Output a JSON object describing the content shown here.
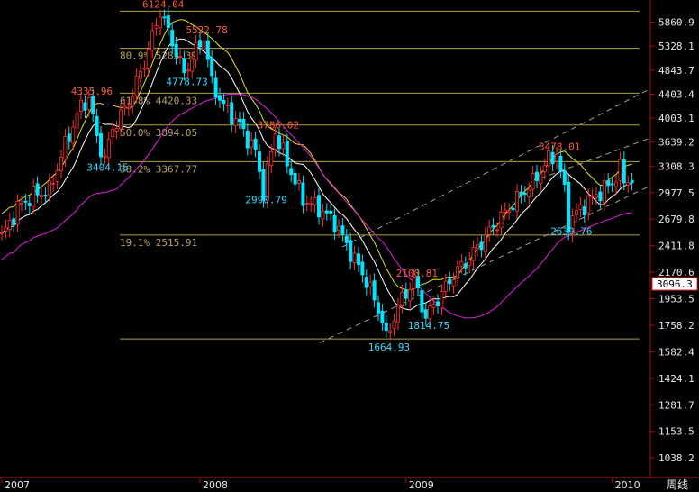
{
  "period_label": "周线",
  "current_price": "3096.3",
  "chart_data": {
    "type": "candlestick",
    "y_scale": "log",
    "ylim": [
      960,
      6400
    ],
    "y_ticks": [
      "5860.9",
      "5328.1",
      "4843.7",
      "4403.4",
      "4003.1",
      "3639.2",
      "3308.3",
      "2977.5",
      "2679.8",
      "2411.8",
      "2170.6",
      "1953.5",
      "1758.2",
      "1582.4",
      "1424.1",
      "1281.7",
      "1153.5",
      "1038.2"
    ],
    "x_ticks": [
      "2007",
      "2008",
      "2009",
      "2010"
    ],
    "colors": {
      "up": "#ff3030",
      "down": "#00e5ff",
      "ma_short": "#ffffff",
      "ma_upper": "#e8e020",
      "ma_lower": "#e020e0",
      "fib": "#b0a040",
      "channel": "#a0a0a0"
    },
    "fib_levels": [
      {
        "label": "",
        "value": 6124
      },
      {
        "label": "80.9% 5283.39",
        "value": 5283
      },
      {
        "label": "61.8% 4420.33",
        "value": 4420
      },
      {
        "label": "50.0% 3894.05",
        "value": 3894
      },
      {
        "label": "38.2% 3367.77",
        "value": 3368
      },
      {
        "label": "19.1% 2515.91",
        "value": 2516
      },
      {
        "label": "",
        "value": 1665
      }
    ],
    "annotations": [
      {
        "text": "6124.04",
        "kind": "high",
        "x": 40,
        "value": 6124
      },
      {
        "text": "5522.78",
        "kind": "high",
        "x": 51,
        "value": 5523
      },
      {
        "text": "4335.96",
        "kind": "high",
        "x": 22,
        "value": 4336
      },
      {
        "text": "4778.73",
        "kind": "low",
        "x": 46,
        "value": 4779
      },
      {
        "text": "3404.15",
        "kind": "low",
        "x": 26,
        "value": 3404
      },
      {
        "text": "3786.02",
        "kind": "high",
        "x": 69,
        "value": 3786
      },
      {
        "text": "2990.79",
        "kind": "low",
        "x": 66,
        "value": 2991
      },
      {
        "text": "2100.81",
        "kind": "high",
        "x": 104,
        "value": 2101
      },
      {
        "text": "1814.75",
        "kind": "low",
        "x": 107,
        "value": 1815
      },
      {
        "text": "1664.93",
        "kind": "low",
        "x": 97,
        "value": 1665
      },
      {
        "text": "3478.01",
        "kind": "high",
        "x": 140,
        "value": 3478
      },
      {
        "text": "2639.76",
        "kind": "low",
        "x": 143,
        "value": 2640
      }
    ],
    "anchors": [
      [
        0,
        2500
      ],
      [
        4,
        2800
      ],
      [
        8,
        2950
      ],
      [
        12,
        3000
      ],
      [
        16,
        3600
      ],
      [
        20,
        4200
      ],
      [
        22,
        4336
      ],
      [
        24,
        3700
      ],
      [
        26,
        3404
      ],
      [
        28,
        3850
      ],
      [
        32,
        4250
      ],
      [
        36,
        5000
      ],
      [
        40,
        6124
      ],
      [
        44,
        5200
      ],
      [
        46,
        4779
      ],
      [
        48,
        5100
      ],
      [
        51,
        5523
      ],
      [
        53,
        4600
      ],
      [
        56,
        4200
      ],
      [
        60,
        3900
      ],
      [
        64,
        3500
      ],
      [
        66,
        2991
      ],
      [
        69,
        3786
      ],
      [
        72,
        3350
      ],
      [
        76,
        2900
      ],
      [
        80,
        2800
      ],
      [
        84,
        2650
      ],
      [
        88,
        2350
      ],
      [
        92,
        2100
      ],
      [
        96,
        1800
      ],
      [
        97,
        1665
      ],
      [
        100,
        1900
      ],
      [
        104,
        2101
      ],
      [
        107,
        1815
      ],
      [
        110,
        1950
      ],
      [
        114,
        2150
      ],
      [
        118,
        2300
      ],
      [
        122,
        2500
      ],
      [
        126,
        2700
      ],
      [
        130,
        2900
      ],
      [
        134,
        3100
      ],
      [
        138,
        3400
      ],
      [
        140,
        3478
      ],
      [
        142,
        3000
      ],
      [
        143,
        2640
      ],
      [
        146,
        2800
      ],
      [
        150,
        2950
      ],
      [
        154,
        3100
      ],
      [
        156,
        3270
      ]
    ]
  }
}
